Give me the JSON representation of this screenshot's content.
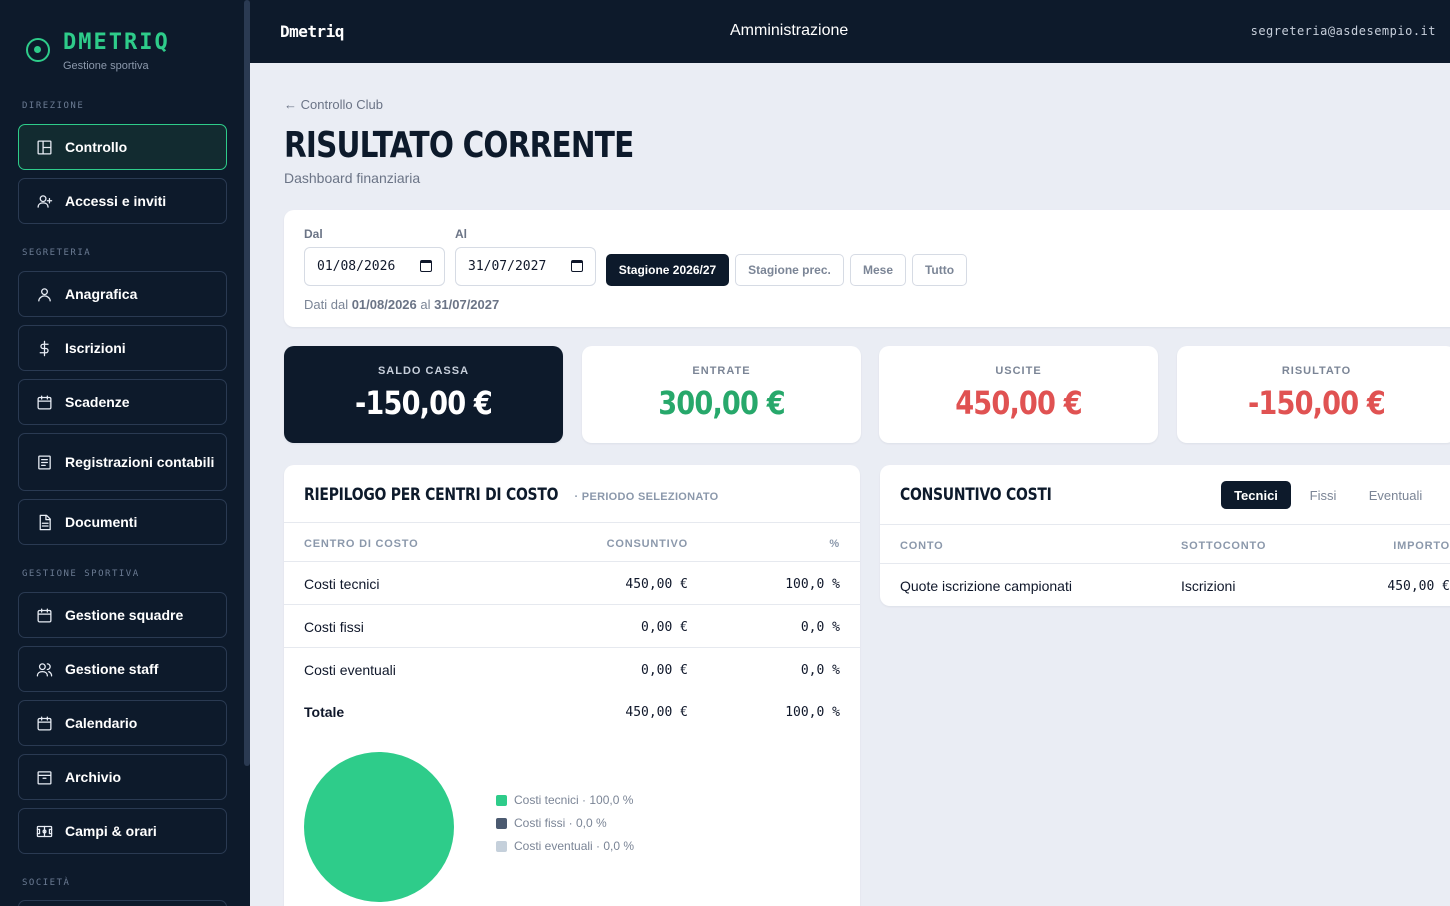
{
  "brand": {
    "name": "DMETRIQ",
    "subtitle": "Gestione sportiva"
  },
  "topbar": {
    "brand": "Dmetriq",
    "title": "Amministrazione",
    "email": "segreteria@asdesempio.it"
  },
  "sidebar": {
    "sections": [
      "DIREZIONE",
      "SEGRETERIA",
      "GESTIONE SPORTIVA",
      "SOCIETÀ"
    ],
    "items": [
      {
        "label": "Controllo",
        "icon": "dashboard-icon",
        "active": true
      },
      {
        "label": "Accessi e inviti",
        "icon": "user-plus-icon"
      },
      {
        "label": "Anagrafica",
        "icon": "user-icon"
      },
      {
        "label": "Iscrizioni",
        "icon": "dollar-icon"
      },
      {
        "label": "Scadenze",
        "icon": "calendar-icon"
      },
      {
        "label": "Registrazioni contabili",
        "icon": "ledger-icon"
      },
      {
        "label": "Documenti",
        "icon": "document-icon"
      },
      {
        "label": "Gestione squadre",
        "icon": "calendar-icon"
      },
      {
        "label": "Gestione staff",
        "icon": "users-icon"
      },
      {
        "label": "Calendario",
        "icon": "calendar-icon"
      },
      {
        "label": "Archivio",
        "icon": "archive-icon"
      },
      {
        "label": "Campi & orari",
        "icon": "field-icon"
      }
    ]
  },
  "page": {
    "back": "← Controllo Club",
    "title": "RISULTATO CORRENTE",
    "subtitle": "Dashboard finanziaria"
  },
  "filters": {
    "from_label": "Dal",
    "from_value": "01/08/2026",
    "to_label": "Al",
    "to_value": "31/07/2027",
    "chips": [
      "Stagione 2026/27",
      "Stagione prec.",
      "Mese",
      "Tutto"
    ],
    "active_chip": "Stagione 2026/27",
    "note_prefix": "Dati dal",
    "note_from": "01/08/2026",
    "note_mid": "al",
    "note_to": "31/07/2027"
  },
  "kpis": [
    {
      "label": "SALDO CASSA",
      "value": "-150,00 €",
      "color": "#ffffff"
    },
    {
      "label": "ENTRATE",
      "value": "300,00 €",
      "color": "#27a86b"
    },
    {
      "label": "USCITE",
      "value": "450,00 €",
      "color": "#e05252"
    },
    {
      "label": "RISULTATO",
      "value": "-150,00 €",
      "color": "#e05252"
    }
  ],
  "cost_centers": {
    "title": "RIEPILOGO PER CENTRI DI COSTO",
    "subtitle": "· PERIODO SELEZIONATO",
    "columns": [
      "CENTRO DI COSTO",
      "CONSUNTIVO",
      "%"
    ],
    "rows": [
      [
        "Costi tecnici",
        "450,00 €",
        "100,0 %"
      ],
      [
        "Costi fissi",
        "0,00 €",
        "0,0 %"
      ],
      [
        "Costi eventuali",
        "0,00 €",
        "0,0 %"
      ]
    ],
    "total": [
      "Totale",
      "450,00 €",
      "100,0 %"
    ]
  },
  "chart_data": {
    "type": "pie",
    "categories": [
      "Costi tecnici",
      "Costi fissi",
      "Costi eventuali"
    ],
    "values": [
      100.0,
      0.0,
      0.0
    ],
    "colors": [
      "#2ecc8a",
      "#4b5a70",
      "#c5d0db"
    ],
    "legend": [
      "Costi tecnici · 100,0 %",
      "Costi fissi · 0,0 %",
      "Costi eventuali · 0,0 %"
    ],
    "legend_position": "right"
  },
  "cost_summary": {
    "title": "CONSUNTIVO COSTI",
    "tabs": [
      "Tecnici",
      "Fissi",
      "Eventuali"
    ],
    "active_tab": "Tecnici",
    "columns": [
      "CONTO",
      "SOTTOCONTO",
      "IMPORTO"
    ],
    "rows": [
      [
        "Quote iscrizione campionati",
        "Iscrizioni",
        "450,00 €"
      ]
    ]
  },
  "colors": {
    "accent": "#2ecc8a",
    "navy": "#0d1a2b",
    "negative": "#e05252",
    "positive": "#27a86b"
  }
}
